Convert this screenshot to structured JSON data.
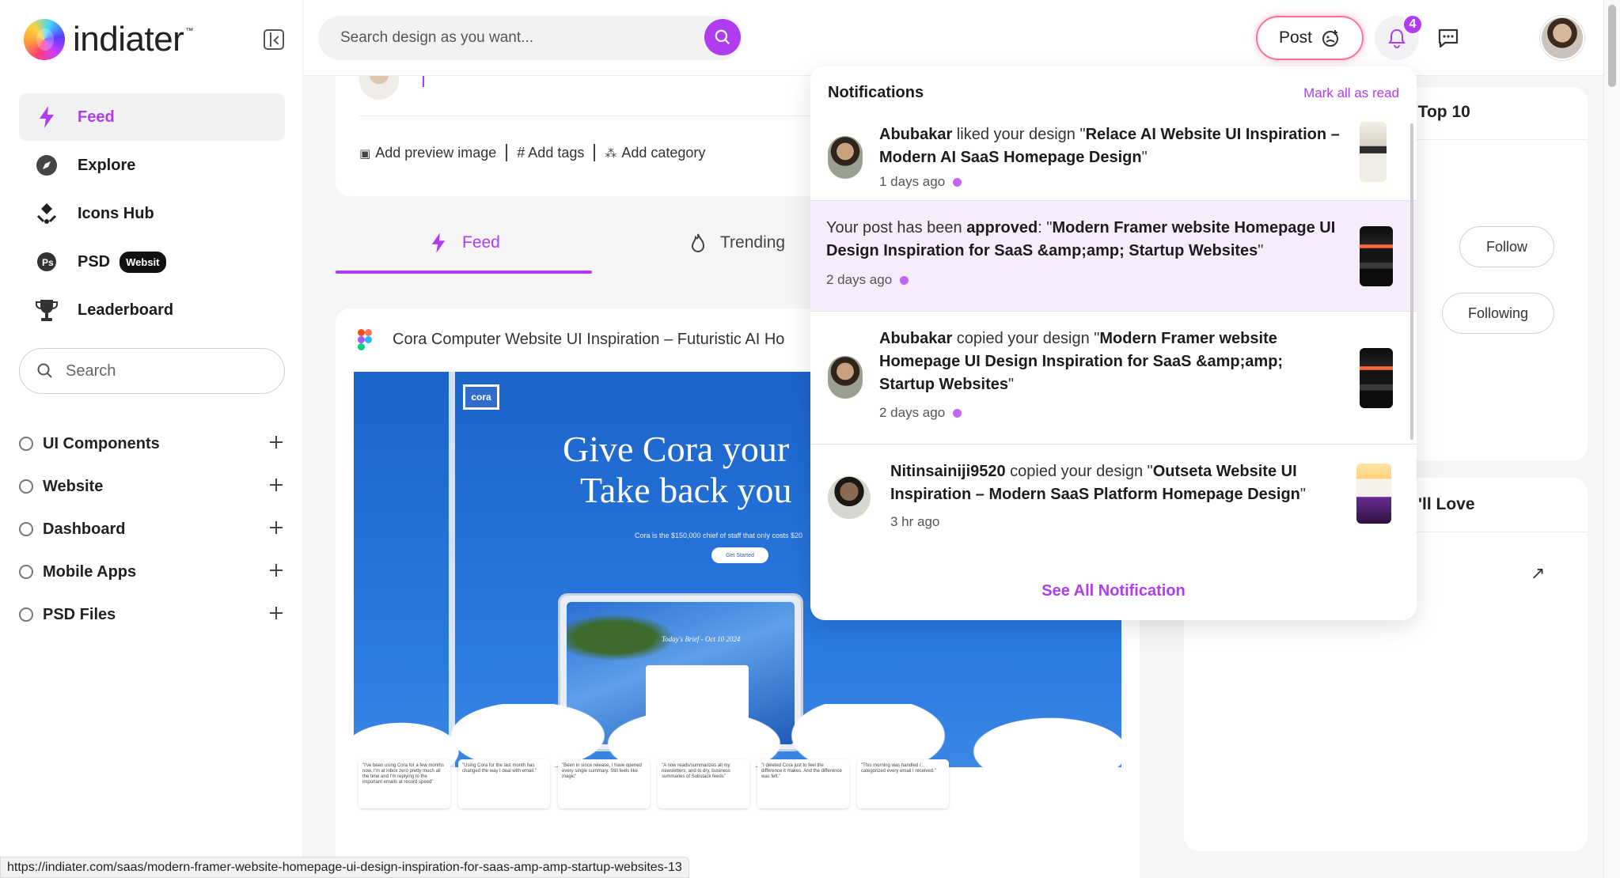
{
  "brand": {
    "name": "indiater",
    "tm": "™",
    "accent": "#b03cf0"
  },
  "sidebar": {
    "nav": [
      {
        "label": "Feed",
        "icon": "bolt-icon",
        "active": true
      },
      {
        "label": "Explore",
        "icon": "compass-icon"
      },
      {
        "label": "Icons Hub",
        "icon": "icons-hub-icon"
      },
      {
        "label": "PSD",
        "icon": "psd-icon",
        "badge": "Websit"
      },
      {
        "label": "Leaderboard",
        "icon": "trophy-icon"
      }
    ],
    "search_label": "Search",
    "categories": [
      "UI Components",
      "Website",
      "Dashboard",
      "Mobile Apps",
      "PSD Files"
    ]
  },
  "topbar": {
    "search_placeholder": "Search design as you want...",
    "post_label": "Post",
    "notification_count": "4"
  },
  "composer": {
    "actions": [
      "Add preview image",
      "# Add tags",
      "Add category"
    ]
  },
  "tabs": {
    "feed": "Feed",
    "trending": "Trending"
  },
  "post": {
    "title": "Cora Computer Website UI Inspiration – Futuristic AI Ho",
    "preview": {
      "logo": "cora",
      "headline_1": "Give Cora your",
      "headline_2": "Take back you",
      "sub": "Cora is the $150,000 chief of staff that only costs $20",
      "cta": "Get Started",
      "brief": "Today's Brief - Oct 10 2024",
      "quotes": [
        "\"I've been using Cora for a few months now. I'm at inbox zero pretty much all the time and I'm replying to the important emails at record speed\"",
        "\"Using Cora for the last month has changed the way I deal with email.\"",
        "\"Been in since release, I have opened every single summary. Still feels like magic\"",
        "\"A now reads/summarizes all my newsletters, and to dry, business summaries of Substack feeds\"",
        "\"I deleted Cora just to feel the difference it makes. And the difference was felt.\"",
        "\"This morning was handled / categorized every email I received.\""
      ]
    }
  },
  "right": {
    "top_head": "rs Top 10",
    "follow_label": "Follow",
    "following_label": "Following",
    "love_head": "'ll Love"
  },
  "notifications": {
    "title": "Notifications",
    "mark_all": "Mark all as read",
    "footer": "See All Notification",
    "items": [
      {
        "user": "Abubakar",
        "action": " liked your design \"",
        "design": "Relace AI Website UI Inspiration – Modern AI SaaS Homepage Design",
        "close": "\"",
        "time": "1 days ago",
        "unread": true
      },
      {
        "prefix": "Your post has been ",
        "status": "approved",
        "mid": ": \"",
        "design": "Modern Framer website Homepage UI Design Inspiration for SaaS &amp;amp; Startup Websites",
        "close": "\"",
        "time": "2 days ago",
        "unread": true
      },
      {
        "user": "Abubakar",
        "action": " copied your design \"",
        "design": "Modern Framer website Homepage UI Design Inspiration for SaaS &amp;amp; Startup Websites",
        "close": "\"",
        "time": "2 days ago",
        "unread": true
      },
      {
        "user": "Nitinsainiji9520",
        "action": " copied your design \"",
        "design": "Outseta Website UI Inspiration – Modern SaaS Platform Homepage Design",
        "close": "\"",
        "time": "3 hr ago",
        "unread": false
      }
    ]
  },
  "status_url": "https://indiater.com/saas/modern-framer-website-homepage-ui-design-inspiration-for-saas-amp-amp-startup-websites-13"
}
